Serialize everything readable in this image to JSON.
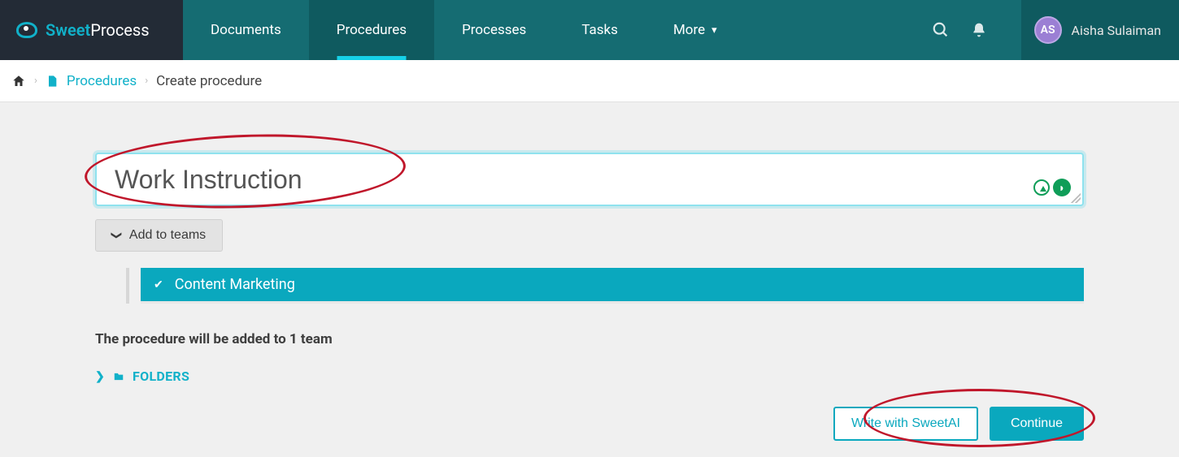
{
  "brand": {
    "left": "Sweet",
    "right": "Process"
  },
  "nav": {
    "documents": "Documents",
    "procedures": "Procedures",
    "processes": "Processes",
    "tasks": "Tasks",
    "more": "More"
  },
  "user": {
    "initials": "AS",
    "name": "Aisha Sulaiman"
  },
  "breadcrumb": {
    "procedures": "Procedures",
    "current": "Create procedure"
  },
  "form": {
    "title_value": "Work Instruction",
    "add_to_teams": "Add to teams",
    "teams": [
      {
        "label": "Content Marketing",
        "checked": true
      }
    ],
    "summary": "The procedure will be added to 1 team",
    "folders_label": "FOLDERS",
    "write_ai": "Write with SweetAI",
    "continue": "Continue"
  }
}
